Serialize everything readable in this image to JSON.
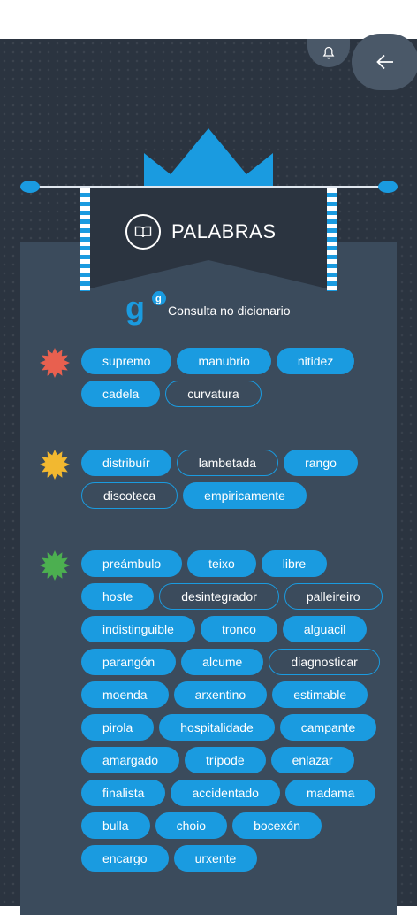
{
  "header": {
    "title": "PALABRAS",
    "subtitle": "Consulta no dicionario",
    "logo_letter": "g",
    "logo_sup": "g"
  },
  "colors": {
    "accent": "#1a9be0",
    "panel": "#3b4b5c",
    "background": "#2b3440",
    "star_red": "#e8604f",
    "star_yellow": "#f2b830",
    "star_green": "#4caf50"
  },
  "icons": {
    "bell": "bell-icon",
    "back": "arrow-left-icon",
    "book": "book-icon"
  },
  "groups": [
    {
      "color": "red",
      "words": [
        {
          "text": "supremo",
          "filled": true
        },
        {
          "text": "manubrio",
          "filled": true
        },
        {
          "text": "nitidez",
          "filled": true
        },
        {
          "text": "cadela",
          "filled": true
        },
        {
          "text": "curvatura",
          "filled": false
        }
      ]
    },
    {
      "color": "yellow",
      "words": [
        {
          "text": "distribuír",
          "filled": true
        },
        {
          "text": "lambetada",
          "filled": false
        },
        {
          "text": "rango",
          "filled": true
        },
        {
          "text": "discoteca",
          "filled": false
        },
        {
          "text": "empiricamente",
          "filled": true
        }
      ]
    },
    {
      "color": "green",
      "words": [
        {
          "text": "preámbulo",
          "filled": true
        },
        {
          "text": "teixo",
          "filled": true
        },
        {
          "text": "libre",
          "filled": true
        },
        {
          "text": "hoste",
          "filled": true
        },
        {
          "text": "desintegrador",
          "filled": false
        },
        {
          "text": "palleireiro",
          "filled": false
        },
        {
          "text": "indistinguible",
          "filled": true
        },
        {
          "text": "tronco",
          "filled": true
        },
        {
          "text": "alguacil",
          "filled": true
        },
        {
          "text": "parangón",
          "filled": true
        },
        {
          "text": "alcume",
          "filled": true
        },
        {
          "text": "diagnosticar",
          "filled": false
        },
        {
          "text": "moenda",
          "filled": true
        },
        {
          "text": "arxentino",
          "filled": true
        },
        {
          "text": "estimable",
          "filled": true
        },
        {
          "text": "pirola",
          "filled": true
        },
        {
          "text": "hospitalidade",
          "filled": true
        },
        {
          "text": "campante",
          "filled": true
        },
        {
          "text": "amargado",
          "filled": true
        },
        {
          "text": "trípode",
          "filled": true
        },
        {
          "text": "enlazar",
          "filled": true
        },
        {
          "text": "finalista",
          "filled": true
        },
        {
          "text": "accidentado",
          "filled": true
        },
        {
          "text": "madama",
          "filled": true
        },
        {
          "text": "bulla",
          "filled": true
        },
        {
          "text": "choio",
          "filled": true
        },
        {
          "text": "bocexón",
          "filled": true
        },
        {
          "text": "encargo",
          "filled": true
        },
        {
          "text": "urxente",
          "filled": true
        }
      ]
    }
  ]
}
